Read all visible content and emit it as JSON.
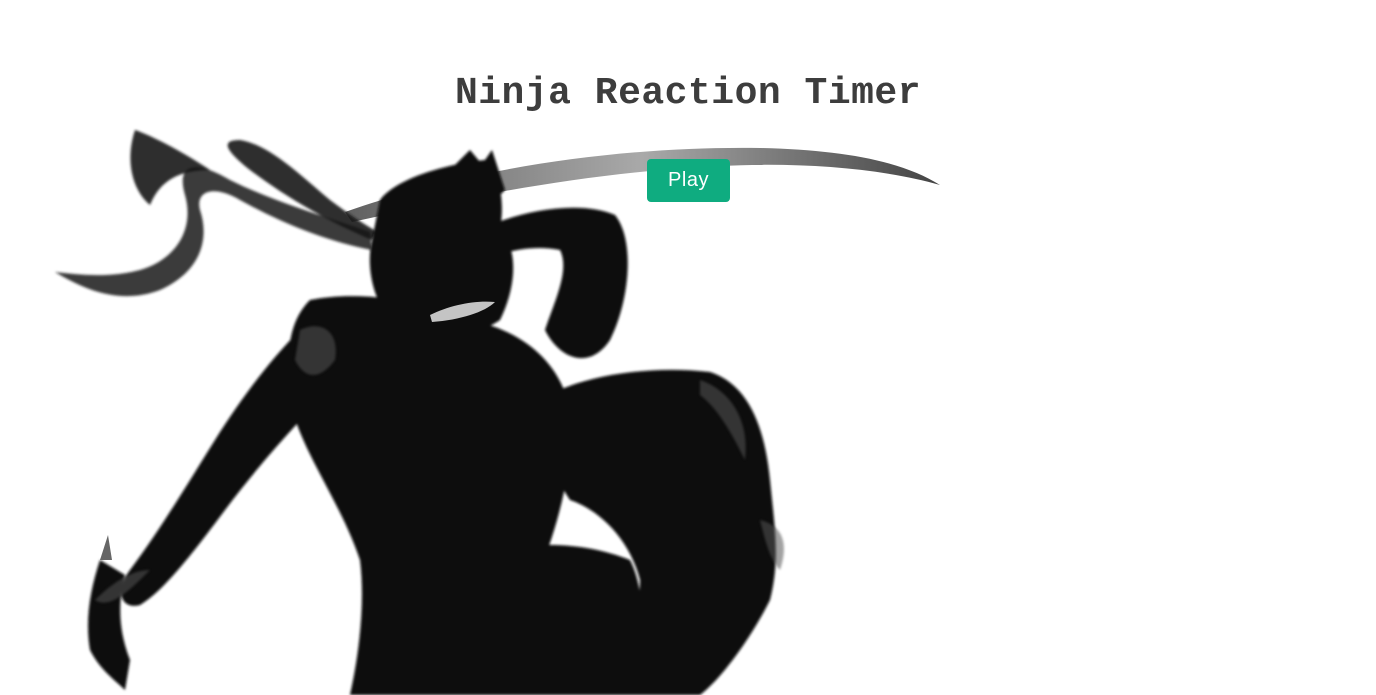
{
  "page": {
    "title": "Ninja Reaction Timer"
  },
  "controls": {
    "play_label": "Play"
  },
  "background": {
    "illustration": "ninja-silhouette-icon"
  },
  "colors": {
    "title_text": "#3d3d3d",
    "play_button_bg": "#0fac80",
    "play_button_text": "#ffffff",
    "ink": "#0a0a0a"
  }
}
